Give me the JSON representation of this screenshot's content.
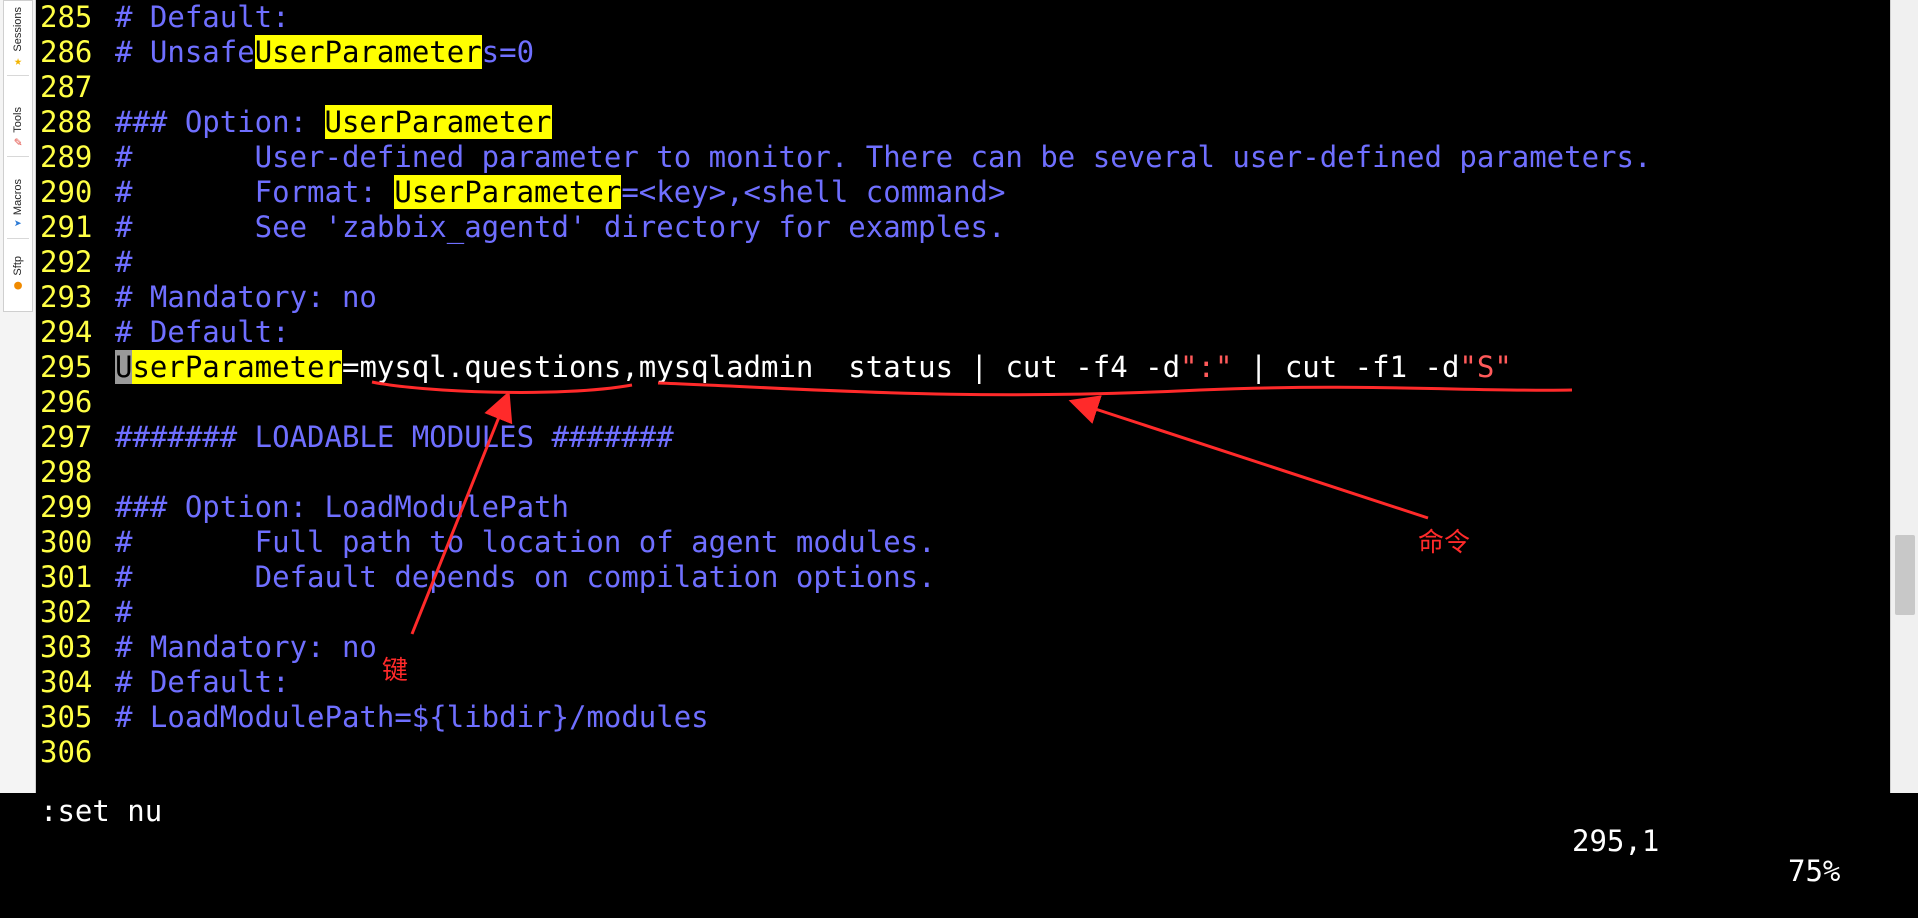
{
  "sidebar": {
    "tabs": [
      {
        "label": "Sessions",
        "icon": "session-icon"
      },
      {
        "label": "Tools",
        "icon": "tools-icon"
      },
      {
        "label": "Macros",
        "icon": "macros-icon"
      },
      {
        "label": "Sftp",
        "icon": "sftp-icon"
      }
    ]
  },
  "editor": {
    "lines": [
      {
        "num": "285",
        "segments": [
          {
            "t": "# Default:",
            "s": "comment"
          }
        ]
      },
      {
        "num": "286",
        "segments": [
          {
            "t": "# Unsafe",
            "s": "comment"
          },
          {
            "t": "UserParameter",
            "s": "hl"
          },
          {
            "t": "s=0",
            "s": "comment"
          }
        ]
      },
      {
        "num": "287",
        "segments": []
      },
      {
        "num": "288",
        "segments": [
          {
            "t": "### Option: ",
            "s": "comment"
          },
          {
            "t": "UserParameter",
            "s": "hl"
          }
        ]
      },
      {
        "num": "289",
        "segments": [
          {
            "t": "#       User-defined parameter to monitor. There can be several user-defined parameters.",
            "s": "comment"
          }
        ]
      },
      {
        "num": "290",
        "segments": [
          {
            "t": "#       Format: ",
            "s": "comment"
          },
          {
            "t": "UserParameter",
            "s": "hl"
          },
          {
            "t": "=<key>,<shell command>",
            "s": "comment"
          }
        ]
      },
      {
        "num": "291",
        "segments": [
          {
            "t": "#       See 'zabbix_agentd' directory for examples.",
            "s": "comment"
          }
        ]
      },
      {
        "num": "292",
        "segments": [
          {
            "t": "#",
            "s": "comment"
          }
        ]
      },
      {
        "num": "293",
        "segments": [
          {
            "t": "# Mandatory: no",
            "s": "comment"
          }
        ]
      },
      {
        "num": "294",
        "segments": [
          {
            "t": "# Default:",
            "s": "comment"
          }
        ]
      },
      {
        "num": "295",
        "segments": [
          {
            "t": "U",
            "s": "cursor"
          },
          {
            "t": "serParameter",
            "s": "hl"
          },
          {
            "t": "=mysql.questions,mysqladmin  status | cut -f4 -d",
            "s": "plain"
          },
          {
            "t": "\":\"",
            "s": "str"
          },
          {
            "t": " | cut -f1 -d",
            "s": "plain"
          },
          {
            "t": "\"S\"",
            "s": "str"
          }
        ]
      },
      {
        "num": "296",
        "segments": []
      },
      {
        "num": "297",
        "segments": [
          {
            "t": "####### LOADABLE MODULES #######",
            "s": "comment"
          }
        ]
      },
      {
        "num": "298",
        "segments": []
      },
      {
        "num": "299",
        "segments": [
          {
            "t": "### Option: LoadModulePath",
            "s": "comment"
          }
        ]
      },
      {
        "num": "300",
        "segments": [
          {
            "t": "#       Full path to location of agent modules.",
            "s": "comment"
          }
        ]
      },
      {
        "num": "301",
        "segments": [
          {
            "t": "#       Default depends on compilation options.",
            "s": "comment"
          }
        ]
      },
      {
        "num": "302",
        "segments": [
          {
            "t": "#",
            "s": "comment"
          }
        ]
      },
      {
        "num": "303",
        "segments": [
          {
            "t": "# Mandatory: no",
            "s": "comment"
          }
        ]
      },
      {
        "num": "304",
        "segments": [
          {
            "t": "# Default:",
            "s": "comment"
          }
        ]
      },
      {
        "num": "305",
        "segments": [
          {
            "t": "# LoadModulePath=${libdir}/modules",
            "s": "comment"
          }
        ]
      },
      {
        "num": "306",
        "segments": []
      }
    ]
  },
  "status": {
    "command": ":set nu",
    "position": "295,1",
    "percent": "75%"
  },
  "scrollbar": {
    "position_pct": 75
  },
  "annotations": {
    "key_label": "键",
    "command_label": "命令",
    "color": "#ff2a2a"
  }
}
